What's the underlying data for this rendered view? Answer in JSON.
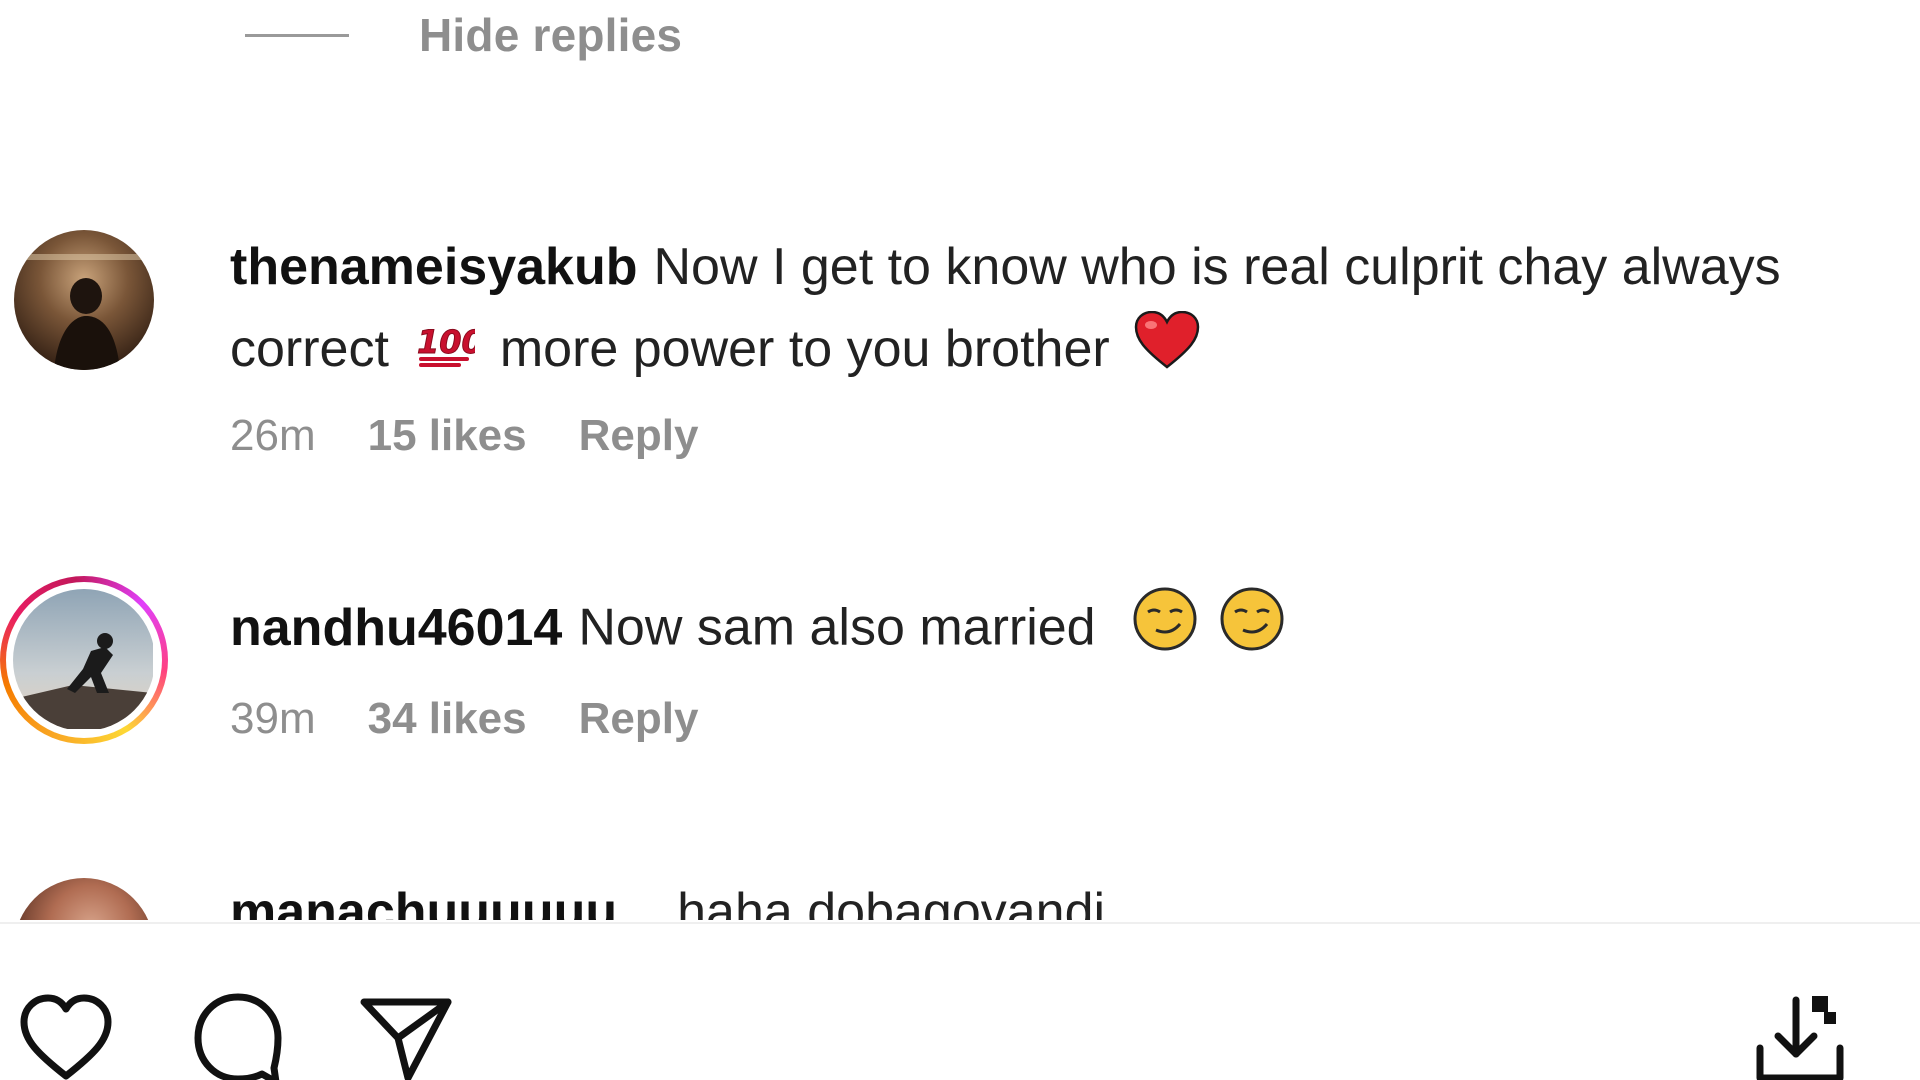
{
  "thread": {
    "hide_replies_label": "Hide replies"
  },
  "comments": [
    {
      "username": "thenameisyakub",
      "text_part1": "Now I get to know who is real culprit chay always correct",
      "emoji1": "hundred-points-emoji",
      "text_part2": "more power to you brother",
      "emoji2": "red-heart-emoji",
      "time": "26m",
      "likes": "15 likes",
      "reply_label": "Reply"
    },
    {
      "username": "nandhu46014",
      "text": "Now sam also married",
      "emojis": [
        "smirking-face-emoji",
        "smirking-face-emoji"
      ],
      "time": "39m",
      "likes": "34 likes",
      "reply_label": "Reply",
      "has_story_ring": true
    },
    {
      "username": "manachuuuuuu",
      "text": "haha dobagovandi"
    }
  ],
  "action_bar": {
    "icons": [
      "heart-icon",
      "comment-icon",
      "share-icon",
      "save-download-icon"
    ]
  },
  "colors": {
    "muted_text": "#8e8e8e",
    "heart_red": "#e0202b",
    "story_ring": [
      "#f9a825",
      "#e91e63",
      "#e040fb"
    ]
  }
}
